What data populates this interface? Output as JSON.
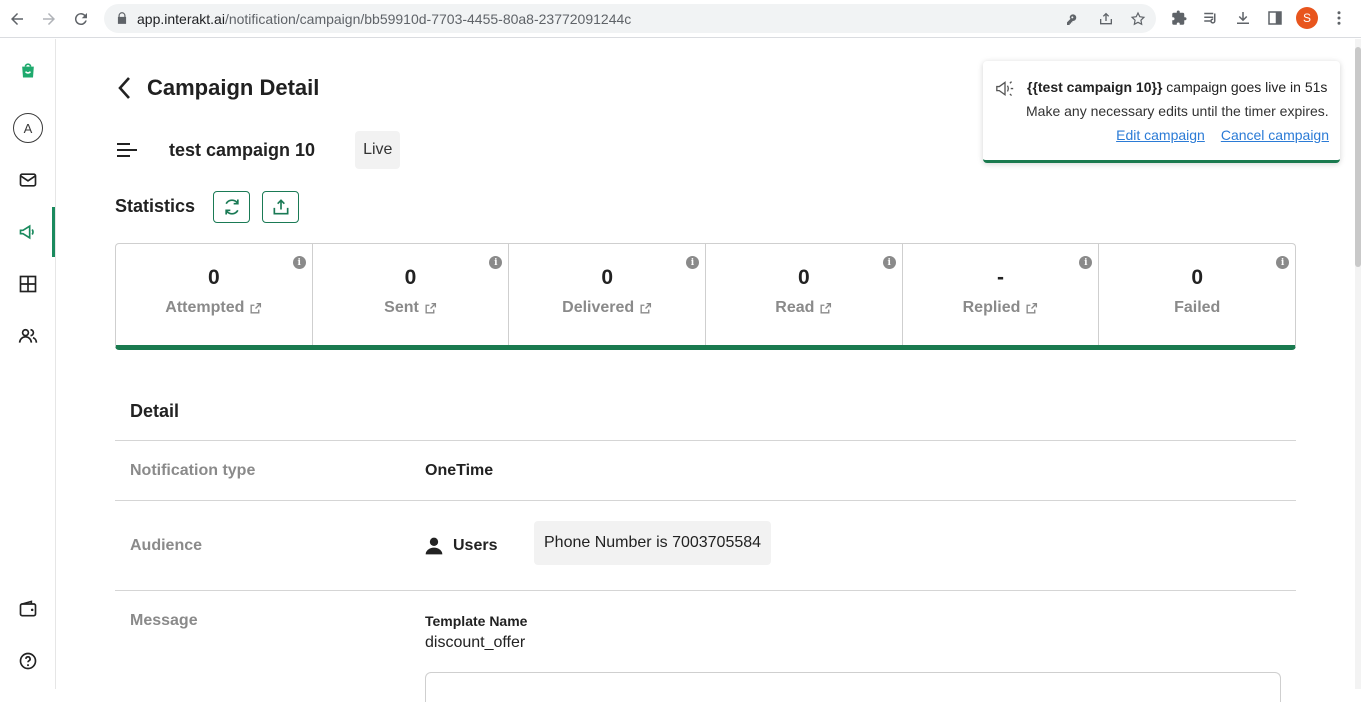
{
  "browser": {
    "url_host": "app.interakt.ai",
    "url_path": "/notification/campaign/bb59910d-7703-4455-80a8-23772091244c",
    "profile_initial": "S"
  },
  "sidebar": {
    "avatar_initial": "A",
    "items": [
      "logo-icon",
      "avatar",
      "mail-icon",
      "megaphone-icon",
      "grid-icon",
      "users-icon",
      "wallet-icon",
      "help-icon"
    ],
    "accent": "#1a8a5e"
  },
  "header": {
    "title": "Campaign Detail"
  },
  "campaign": {
    "name": "test campaign 10",
    "status": "Live"
  },
  "statistics": {
    "title": "Statistics",
    "items": [
      {
        "value": "0",
        "label": "Attempted"
      },
      {
        "value": "0",
        "label": "Sent"
      },
      {
        "value": "0",
        "label": "Delivered"
      },
      {
        "value": "0",
        "label": "Read"
      },
      {
        "value": "-",
        "label": "Replied"
      },
      {
        "value": "0",
        "label": "Failed"
      }
    ]
  },
  "detail": {
    "heading": "Detail",
    "notification_type_label": "Notification type",
    "notification_type_value": "OneTime",
    "audience_label": "Audience",
    "audience_type": "Users",
    "audience_filter": "Phone Number is 7003705584",
    "message_label": "Message",
    "template_name_label": "Template Name",
    "template_name_value": "discount_offer"
  },
  "toast": {
    "campaign_token": "{{test campaign 10}}",
    "line1_rest": " campaign goes live in 51s",
    "line2": "Make any necessary edits until the timer expires.",
    "edit_link": "Edit campaign",
    "cancel_link": "Cancel campaign"
  },
  "colors": {
    "brand_green": "#1a7a4f",
    "link_blue": "#2b7bd6"
  }
}
